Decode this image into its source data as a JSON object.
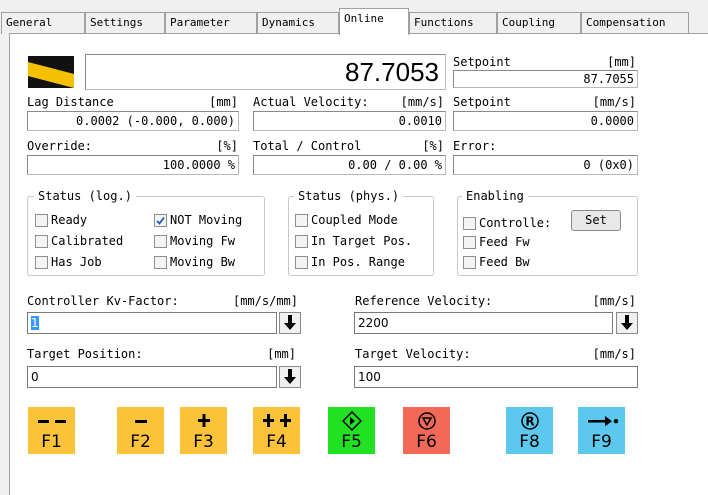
{
  "tabs": [
    "General",
    "Settings",
    "Parameter",
    "Dynamics",
    "Online",
    "Functions",
    "Coupling",
    "Compensation"
  ],
  "active_tab": "Online",
  "position": {
    "value": "87.7053"
  },
  "setpoint_pos": {
    "label": "Setpoint",
    "unit": "[mm]",
    "value": "87.7055"
  },
  "lag": {
    "label": "Lag Distance",
    "unit": "[mm]",
    "value": "0.0002  (-0.000, 0.000)"
  },
  "actual_velocity": {
    "label": "Actual Velocity:",
    "unit": "[mm/s]",
    "value": "0.0010"
  },
  "setpoint_vel": {
    "label": "Setpoint",
    "unit": "[mm/s]",
    "value": "0.0000"
  },
  "override": {
    "label": "Override:",
    "unit": "[%]",
    "value": "100.0000 %"
  },
  "total_control": {
    "label": "Total / Control",
    "unit": "[%]",
    "value": "0.00 /  0.00 %"
  },
  "error": {
    "label": "Error:",
    "value": "0 (0x0)"
  },
  "status_log": {
    "title": "Status (log.)",
    "items": [
      {
        "label": "Ready",
        "checked": false
      },
      {
        "label": "Calibrated",
        "checked": false
      },
      {
        "label": "Has Job",
        "checked": false
      },
      {
        "label": "NOT Moving",
        "checked": true
      },
      {
        "label": "Moving Fw",
        "checked": false
      },
      {
        "label": "Moving Bw",
        "checked": false
      }
    ]
  },
  "status_phys": {
    "title": "Status (phys.)",
    "items": [
      {
        "label": "Coupled Mode",
        "checked": false
      },
      {
        "label": "In Target Pos.",
        "checked": false
      },
      {
        "label": "In Pos. Range",
        "checked": false
      }
    ]
  },
  "enabling": {
    "title": "Enabling",
    "items": [
      {
        "label": "Controlle:",
        "checked": false
      },
      {
        "label": "Feed Fw",
        "checked": false
      },
      {
        "label": "Feed Bw",
        "checked": false
      }
    ],
    "set_label": "Set"
  },
  "kv_factor": {
    "label": "Controller Kv-Factor:",
    "unit": "[mm/s/mm]",
    "value": "1"
  },
  "ref_velocity": {
    "label": "Reference Velocity:",
    "unit": "[mm/s]",
    "value": "2200"
  },
  "target_position": {
    "label": "Target Position:",
    "unit": "[mm]",
    "value": "0"
  },
  "target_velocity": {
    "label": "Target Velocity:",
    "unit": "[mm/s]",
    "value": "100"
  },
  "fkeys": [
    {
      "label": "F1",
      "icon": "fast-reverse-icon",
      "color": "#fcc33a"
    },
    {
      "label": "F2",
      "icon": "reverse-icon",
      "color": "#fcc33a"
    },
    {
      "label": "F3",
      "icon": "forward-icon",
      "color": "#fcc33a"
    },
    {
      "label": "F4",
      "icon": "fast-forward-icon",
      "color": "#fcc33a"
    },
    {
      "label": "F5",
      "icon": "start-icon",
      "color": "#22e022"
    },
    {
      "label": "F6",
      "icon": "stop-icon",
      "color": "#f46858"
    },
    {
      "label": "F8",
      "icon": "reset-icon",
      "color": "#5cc8ee"
    },
    {
      "label": "F9",
      "icon": "goto-target-icon",
      "color": "#5cc8ee"
    }
  ]
}
